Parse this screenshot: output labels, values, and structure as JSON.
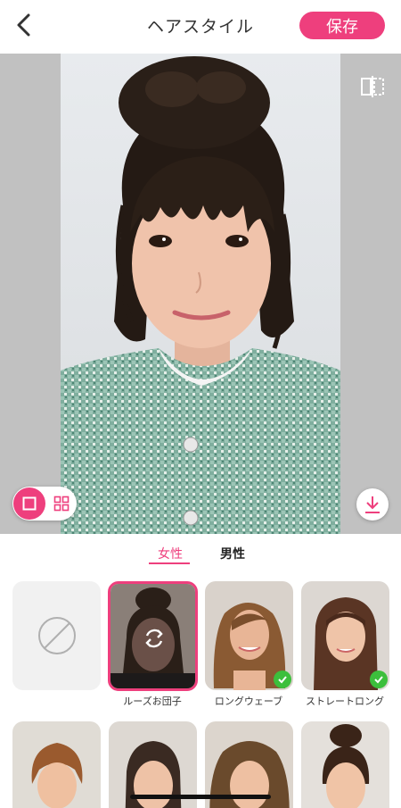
{
  "header": {
    "title": "ヘアスタイル",
    "save_label": "保存"
  },
  "tabs": [
    {
      "label": "女性",
      "active": true
    },
    {
      "label": "男性",
      "active": false
    }
  ],
  "styles": [
    {
      "label": "",
      "icon": "none-icon"
    },
    {
      "label": "ルーズお団子",
      "selected": true
    },
    {
      "label": "ロングウェーブ",
      "checked": true
    },
    {
      "label": "ストレートロング",
      "checked": true
    }
  ],
  "colors": {
    "accent": "#ee3f7d",
    "check": "#3cbf3c"
  }
}
